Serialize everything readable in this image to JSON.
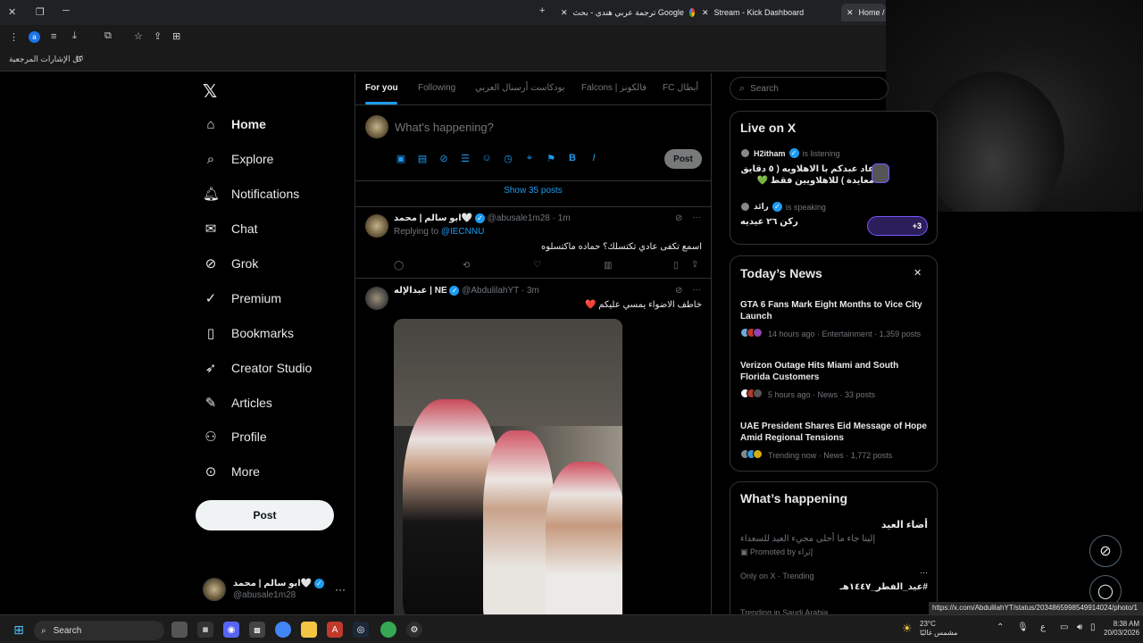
{
  "browser": {
    "tabs": [
      {
        "label": "ترجمة عربي هندي - بحث Google"
      },
      {
        "label": "Stream - Kick Dashboard"
      },
      {
        "label": "Home / X"
      }
    ],
    "bookmarks_label": "كل الإشارات المرجعية",
    "profile_letter": "a",
    "url_tooltip": "https://x.com/AbdulilahYT/status/2034865998549914024/photo/1"
  },
  "nav": {
    "items": [
      {
        "label": "Home",
        "icon": "home-icon"
      },
      {
        "label": "Explore",
        "icon": "search-icon"
      },
      {
        "label": "Notifications",
        "icon": "bell-icon"
      },
      {
        "label": "Chat",
        "icon": "mail-icon"
      },
      {
        "label": "Grok",
        "icon": "grok-icon"
      },
      {
        "label": "Premium",
        "icon": "premium-icon"
      },
      {
        "label": "Bookmarks",
        "icon": "bookmark-icon"
      },
      {
        "label": "Creator Studio",
        "icon": "rocket-icon"
      },
      {
        "label": "Articles",
        "icon": "article-icon"
      },
      {
        "label": "Profile",
        "icon": "person-icon"
      },
      {
        "label": "More",
        "icon": "more-icon"
      }
    ],
    "post_label": "Post",
    "account": {
      "name": "ابو سالم | محمد🤍",
      "handle": "@abusale1m28",
      "menu": "···"
    }
  },
  "feed": {
    "tabs": [
      "For you",
      "Following",
      "بودكاست أرسنال العربي",
      "Falcons | فالكونز",
      "FC أبطال"
    ],
    "composer_placeholder": "What's happening?",
    "composer_post": "Post",
    "show_posts": "Show 35 posts",
    "tweets": [
      {
        "name": "ابو سالم | محمد🤍",
        "handle": "@abusale1m28",
        "time": "· 1m",
        "reply_prefix": "Replying to",
        "reply_to": "@IECNNU",
        "text": "اسمع تكفى عادي تكتسلك؟ حماده ماكتسلوه"
      },
      {
        "name": "عبدالإله | NE",
        "handle": "@AbdulilahYT",
        "time": "· 3m",
        "text": "خاطف الاضواء يمسي عليكم ❤️"
      }
    ]
  },
  "right": {
    "search_placeholder": "Search",
    "live": {
      "title": "Live on X",
      "spaces": [
        {
          "user": "H2itham",
          "status": "is listening",
          "text": "عاد عبدكم با الاهلاويه ( ٥ دقايق معايدة ) للاهلاويين فقط 💚"
        },
        {
          "user": "رائد",
          "status": "is speaking",
          "text": "ركن ٢٦ عيديه",
          "extra": "+3"
        }
      ]
    },
    "news": {
      "title": "Today’s News",
      "close": "✕",
      "items": [
        {
          "headline": "GTA 6 Fans Mark Eight Months to Vice City Launch",
          "meta": "14 hours ago · Entertainment · 1,359 posts"
        },
        {
          "headline": "Verizon Outage Hits Miami and South Florida Customers",
          "meta": "5 hours ago · News · 33 posts"
        },
        {
          "headline": "UAE President Shares Eid Message of Hope Amid Regional Tensions",
          "meta": "Trending now · News · 1,772 posts"
        }
      ]
    },
    "happening": {
      "title": "What’s happening",
      "promo_title": "أضاء العيد",
      "promo_text": "إلينا جاء ما أحلى مجيء العيد للسعداء",
      "promo_by": "Promoted by إثراء",
      "trend_meta": "Only on X · Trending",
      "trend_name": "#عيد_الفطر_١٤٤٧هـ",
      "trend_meta2": "Trending in Saudi Arabia",
      "menu": "···"
    }
  },
  "taskbar": {
    "search": "Search",
    "weather_temp": "23°C",
    "weather_desc": "مشمس غالبًا",
    "lang": "ع",
    "time": "8:38 AM",
    "date": "20/03/2026"
  },
  "colors": {
    "accent": "#1d9bf0",
    "background": "#000000",
    "border": "#2f3336",
    "muted": "#71767b",
    "space": "#7856ff"
  }
}
